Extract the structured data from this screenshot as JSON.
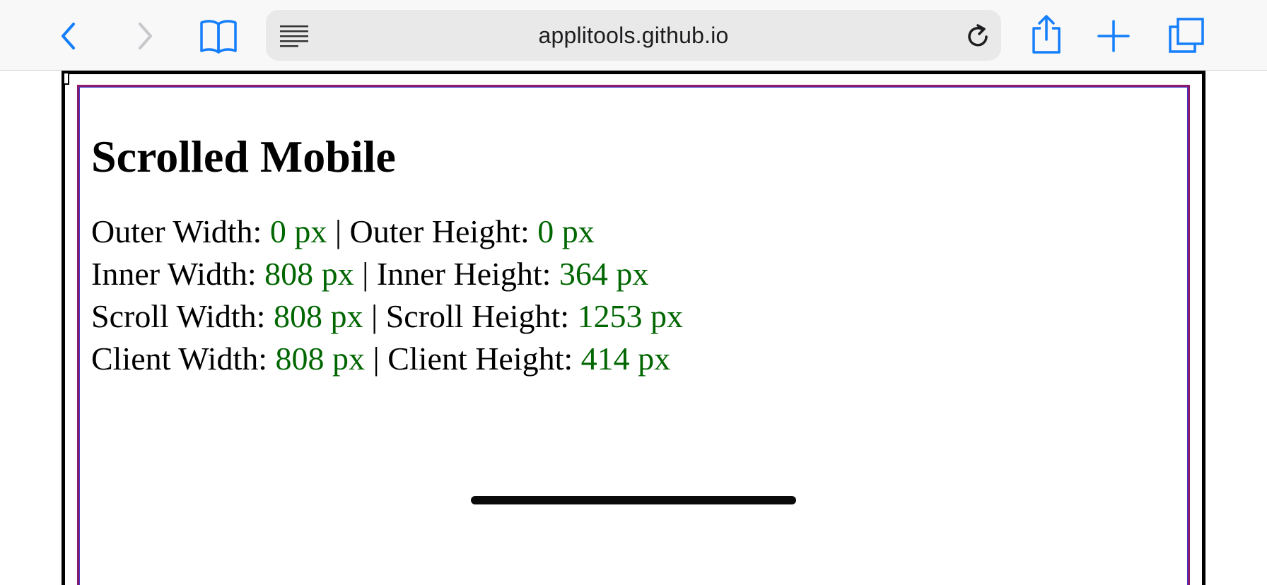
{
  "browser": {
    "url": "applitools.github.io",
    "icons": {
      "back": "chevron-left-icon",
      "forward": "chevron-right-icon",
      "bookmarks": "book-icon",
      "reader": "reader-lines-icon",
      "reload": "reload-icon",
      "share": "share-icon",
      "new_tab": "plus-icon",
      "tabs": "tabs-icon"
    },
    "accent_color": "#147efb",
    "disabled_color": "#c7c7cc"
  },
  "page": {
    "title": "Scrolled Mobile",
    "separator": " | ",
    "value_color": "#006600",
    "metrics": [
      {
        "left_label": "Outer Width: ",
        "left_value": "0 px",
        "right_label": "Outer Height: ",
        "right_value": "0 px"
      },
      {
        "left_label": "Inner Width: ",
        "left_value": "808 px",
        "right_label": "Inner Height: ",
        "right_value": "364 px"
      },
      {
        "left_label": "Scroll Width: ",
        "left_value": "808 px",
        "right_label": "Scroll Height: ",
        "right_value": "1253 px"
      },
      {
        "left_label": "Client Width: ",
        "left_value": "808 px",
        "right_label": "Client Height: ",
        "right_value": "414 px"
      }
    ]
  }
}
